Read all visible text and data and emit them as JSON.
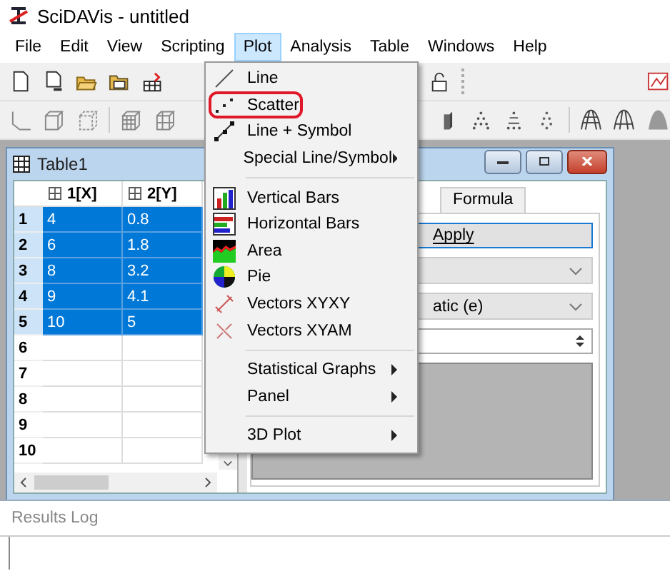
{
  "window": {
    "title": "SciDAVis - untitled"
  },
  "menubar": [
    {
      "label": "File",
      "selected": false
    },
    {
      "label": "Edit",
      "selected": false
    },
    {
      "label": "View",
      "selected": false
    },
    {
      "label": "Scripting",
      "selected": false
    },
    {
      "label": "Plot",
      "selected": true
    },
    {
      "label": "Analysis",
      "selected": false
    },
    {
      "label": "Table",
      "selected": false
    },
    {
      "label": "Windows",
      "selected": false
    },
    {
      "label": "Help",
      "selected": false
    }
  ],
  "plot_menu": {
    "sections": [
      {
        "items": [
          {
            "label": "Line",
            "submenu": false,
            "highlighted": false
          },
          {
            "label": "Scatter",
            "submenu": false,
            "highlighted": true
          },
          {
            "label": "Line + Symbol",
            "submenu": false,
            "highlighted": false
          },
          {
            "label": "Special Line/Symbol",
            "submenu": true,
            "highlighted": false
          }
        ]
      },
      {
        "items": [
          {
            "label": "Vertical Bars",
            "submenu": false,
            "highlighted": false
          },
          {
            "label": "Horizontal Bars",
            "submenu": false,
            "highlighted": false
          },
          {
            "label": "Area",
            "submenu": false,
            "highlighted": false
          },
          {
            "label": "Pie",
            "submenu": false,
            "highlighted": false
          },
          {
            "label": "Vectors XYXY",
            "submenu": false,
            "highlighted": false
          },
          {
            "label": "Vectors XYAM",
            "submenu": false,
            "highlighted": false
          }
        ]
      },
      {
        "items": [
          {
            "label": "Statistical Graphs",
            "submenu": true,
            "highlighted": false
          },
          {
            "label": "Panel",
            "submenu": true,
            "highlighted": false
          }
        ]
      },
      {
        "items": [
          {
            "label": "3D Plot",
            "submenu": true,
            "highlighted": false
          }
        ]
      }
    ]
  },
  "table_window": {
    "title": "Table1",
    "columns": [
      "1[X]",
      "2[Y]"
    ],
    "rows": [
      {
        "label": "1",
        "cells": [
          "4",
          "0.8"
        ],
        "selected": true
      },
      {
        "label": "2",
        "cells": [
          "6",
          "1.8"
        ],
        "selected": true
      },
      {
        "label": "3",
        "cells": [
          "8",
          "3.2"
        ],
        "selected": true
      },
      {
        "label": "4",
        "cells": [
          "9",
          "4.1"
        ],
        "selected": true
      },
      {
        "label": "5",
        "cells": [
          "10",
          "5"
        ],
        "selected": true
      },
      {
        "label": "6",
        "cells": [],
        "selected": false
      },
      {
        "label": "7",
        "cells": [],
        "selected": false
      },
      {
        "label": "8",
        "cells": [],
        "selected": false
      },
      {
        "label": "9",
        "cells": [],
        "selected": false
      },
      {
        "label": "10",
        "cells": [],
        "selected": false
      }
    ],
    "tabs": [
      {
        "label": "Formula",
        "selected": false
      }
    ],
    "apply_button": "Apply",
    "format_combo": "atic (e)"
  },
  "results_log": {
    "title": "Results Log"
  }
}
